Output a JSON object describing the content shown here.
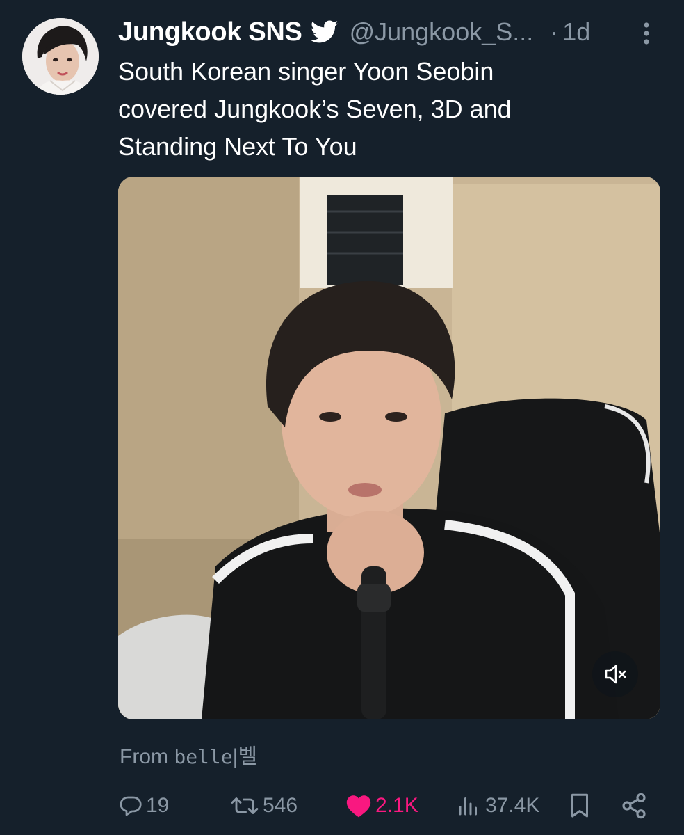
{
  "author": {
    "display_name": "Jungkook SNS",
    "handle": "@Jungkook_S...",
    "verified_icon": "twitter-bird-icon"
  },
  "meta": {
    "separator": "·",
    "time": "1d"
  },
  "tweet": {
    "text_lines": [
      "South Korean singer Yoon Seobin",
      "covered Jungkook’s Seven, 3D and",
      "Standing Next To You"
    ]
  },
  "media": {
    "type": "video",
    "mute_icon": "volume-muted-icon"
  },
  "attribution": {
    "prefix": "From",
    "source": "belle",
    "separator": "|",
    "source_korean": "벨"
  },
  "actions": {
    "replies": "19",
    "retweets": "546",
    "likes": "2.1K",
    "views": "37.4K"
  },
  "colors": {
    "background": "#15202b",
    "text_primary": "#ffffff",
    "text_secondary": "#8b98a5",
    "like": "#f91880"
  }
}
